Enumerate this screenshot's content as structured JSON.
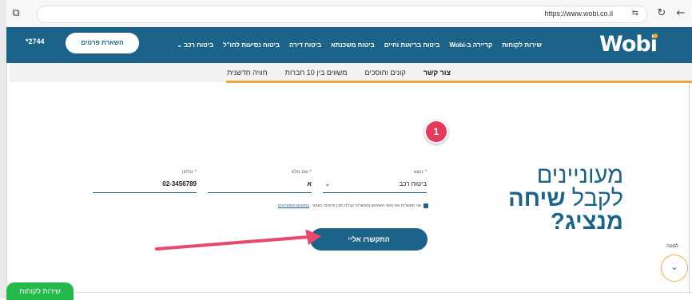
{
  "browser": {
    "url": "https://www.wobi.co.il"
  },
  "header": {
    "logo": "Wobi",
    "nav": [
      "ביטוח רכב",
      "ביטוח נסיעות לחו\"ל",
      "ביטוח דירה",
      "ביטוח משכנתא",
      "ביטוח בריאות וחיים",
      "קריירה ב-Wobi",
      "שירות לקוחות"
    ],
    "cta": "השארת פרטים",
    "phone": "*2744"
  },
  "subnav": [
    "חוויה חדשנית",
    "משווים בין 10 חברות",
    "קונים וחוסכים",
    "צור קשר"
  ],
  "badge": "1",
  "headline": {
    "line1": "מעוניינים",
    "line2_regular": "לקבל",
    "line2_bold": "שיחה",
    "line3": "מנציג?"
  },
  "form": {
    "subject_label": "נושא",
    "subject_value": "ביטוח רכב",
    "name_label": "שם מלא",
    "name_value": "א",
    "phone_label": "טלפון",
    "phone_value": "02-3456789",
    "consent_text": "אני מאשר/ת את תנאי השימוש ומאשר/ת קבלת תוכן פרסומי כאמור",
    "consent_link": "בתנאים המפורטים",
    "submit": "התקשרו אליי"
  },
  "scroll_down_label": "למטה",
  "service_button": "שירות לקוחות",
  "colors": {
    "brand": "#1b6388",
    "accent": "#f2a93b",
    "badge": "#e5395d",
    "service": "#25b84a"
  }
}
